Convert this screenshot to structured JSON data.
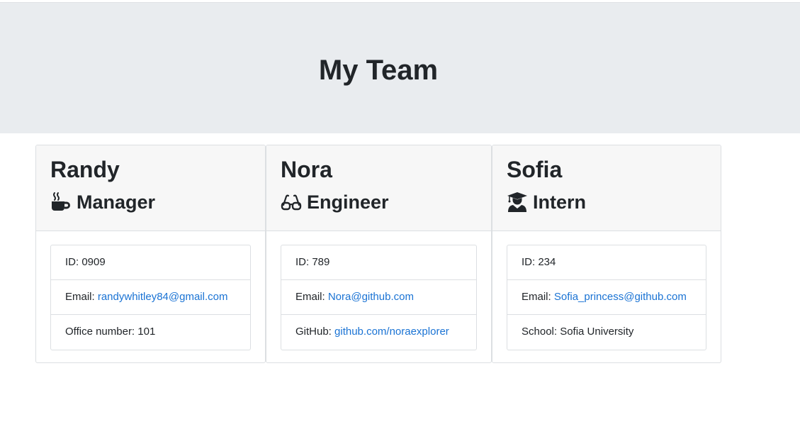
{
  "page": {
    "title": "My Team"
  },
  "team": [
    {
      "name": "Randy",
      "role": "Manager",
      "icon": "coffee-mug-icon",
      "details": [
        {
          "label": "ID: ",
          "value": "0909",
          "link": false
        },
        {
          "label": "Email: ",
          "value": "randywhitley84@gmail.com",
          "link": true
        },
        {
          "label": "Office number: ",
          "value": "101",
          "link": false
        }
      ]
    },
    {
      "name": "Nora",
      "role": "Engineer",
      "icon": "glasses-icon",
      "details": [
        {
          "label": "ID: ",
          "value": "789",
          "link": false
        },
        {
          "label": "Email: ",
          "value": "Nora@github.com",
          "link": true
        },
        {
          "label": "GitHub: ",
          "value": "github.com/noraexplorer",
          "link": true
        }
      ]
    },
    {
      "name": "Sofia",
      "role": "Intern",
      "icon": "graduate-icon",
      "details": [
        {
          "label": "ID: ",
          "value": "234",
          "link": false
        },
        {
          "label": "Email: ",
          "value": "Sofia_princess@github.com",
          "link": true
        },
        {
          "label": "School: ",
          "value": "Sofia University",
          "link": false
        }
      ]
    }
  ],
  "colors": {
    "header_bg": "#e9ecef",
    "card_header_bg": "#f7f7f7",
    "link": "#1a73d4",
    "text": "#212529"
  }
}
